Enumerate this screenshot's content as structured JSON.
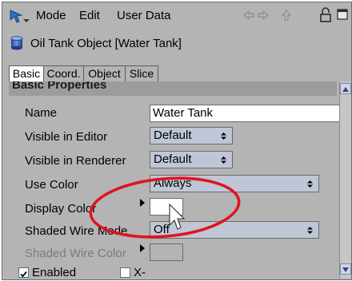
{
  "menubar": {
    "items": [
      "Mode",
      "Edit",
      "User Data"
    ]
  },
  "object": {
    "title": "Oil Tank Object [Water Tank]"
  },
  "tabs": [
    {
      "label": "Basic",
      "active": true
    },
    {
      "label": "Coord.",
      "active": false
    },
    {
      "label": "Object",
      "active": false
    },
    {
      "label": "Slice",
      "active": false
    }
  ],
  "section": {
    "title": "Basic Properties"
  },
  "properties": {
    "name": {
      "label": "Name",
      "value": "Water Tank"
    },
    "visible_editor": {
      "label": "Visible in Editor",
      "value": "Default"
    },
    "visible_renderer": {
      "label": "Visible in Renderer",
      "value": "Default"
    },
    "use_color": {
      "label": "Use Color",
      "value": "Always"
    },
    "display_color": {
      "label": "Display Color",
      "color": "#ffffff"
    },
    "shaded_wire_mode": {
      "label": "Shaded Wire Mode",
      "value": "Off"
    },
    "shaded_wire_color": {
      "label": "Shaded Wire Color",
      "color": "#b4b4b4"
    }
  },
  "checkboxes": {
    "enabled": {
      "label": "Enabled",
      "checked": true
    },
    "xray": {
      "label": "X-Ray",
      "checked": false
    }
  },
  "annotation": {
    "ellipse_color": "#e0141e"
  }
}
